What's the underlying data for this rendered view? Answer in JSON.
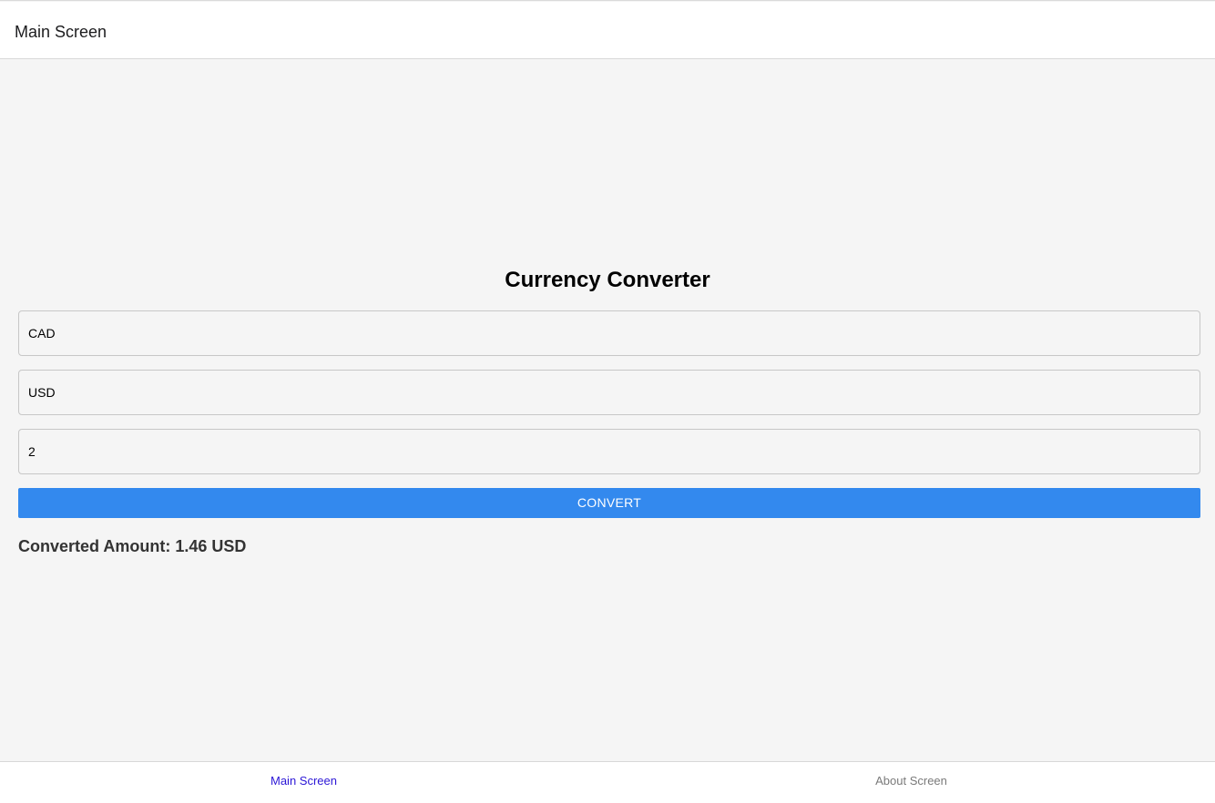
{
  "header": {
    "title": "Main Screen"
  },
  "main": {
    "title": "Currency Converter",
    "from_currency": {
      "value": "CAD"
    },
    "to_currency": {
      "value": "USD"
    },
    "amount": {
      "value": "2"
    },
    "convert_label": "CONVERT",
    "result_text": "Converted Amount: 1.46 USD"
  },
  "tabs": [
    {
      "label": "Main Screen",
      "active": true
    },
    {
      "label": "About Screen",
      "active": false
    }
  ],
  "colors": {
    "accent": "#3389ee",
    "active_tab": "#2b16d6",
    "inactive_tab": "#7a7a7a",
    "background": "#f5f5f5"
  }
}
